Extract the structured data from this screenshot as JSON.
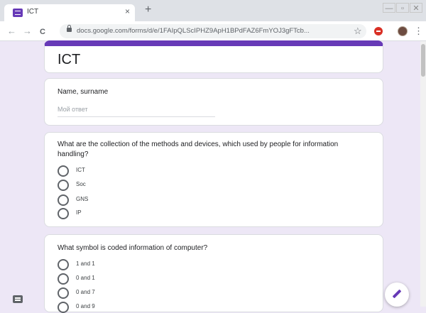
{
  "browser": {
    "tab_title": "ICT",
    "tab_close": "×",
    "new_tab": "+",
    "window_controls": [
      "—",
      "▫",
      "✕"
    ],
    "nav": {
      "back": "←",
      "forward": "→",
      "reload": "C"
    },
    "url": "docs.google.com/forms/d/e/1FAIpQLScIPHZ9ApH1BPdFAZ6FmYOJ3gFTcb...",
    "star": "☆",
    "menu": "⋮",
    "icons": {
      "lock": "lock-icon",
      "extension": "adblock-icon",
      "profile": "avatar",
      "star": "star-icon"
    }
  },
  "form": {
    "title": "ICT",
    "accent_color": "#673ab7",
    "name_question": {
      "label": "Name, surname",
      "placeholder": "Мой ответ"
    },
    "questions": [
      {
        "text": "What are the collection of the methods and devices, which used by people for information handling?",
        "options": [
          "ICT",
          "Soc",
          "GNS",
          "IP"
        ]
      },
      {
        "text": "What symbol is coded information of computer?",
        "options": [
          "1 and 1",
          "0 and 1",
          "0 and 7",
          "0 and 9"
        ]
      }
    ]
  }
}
